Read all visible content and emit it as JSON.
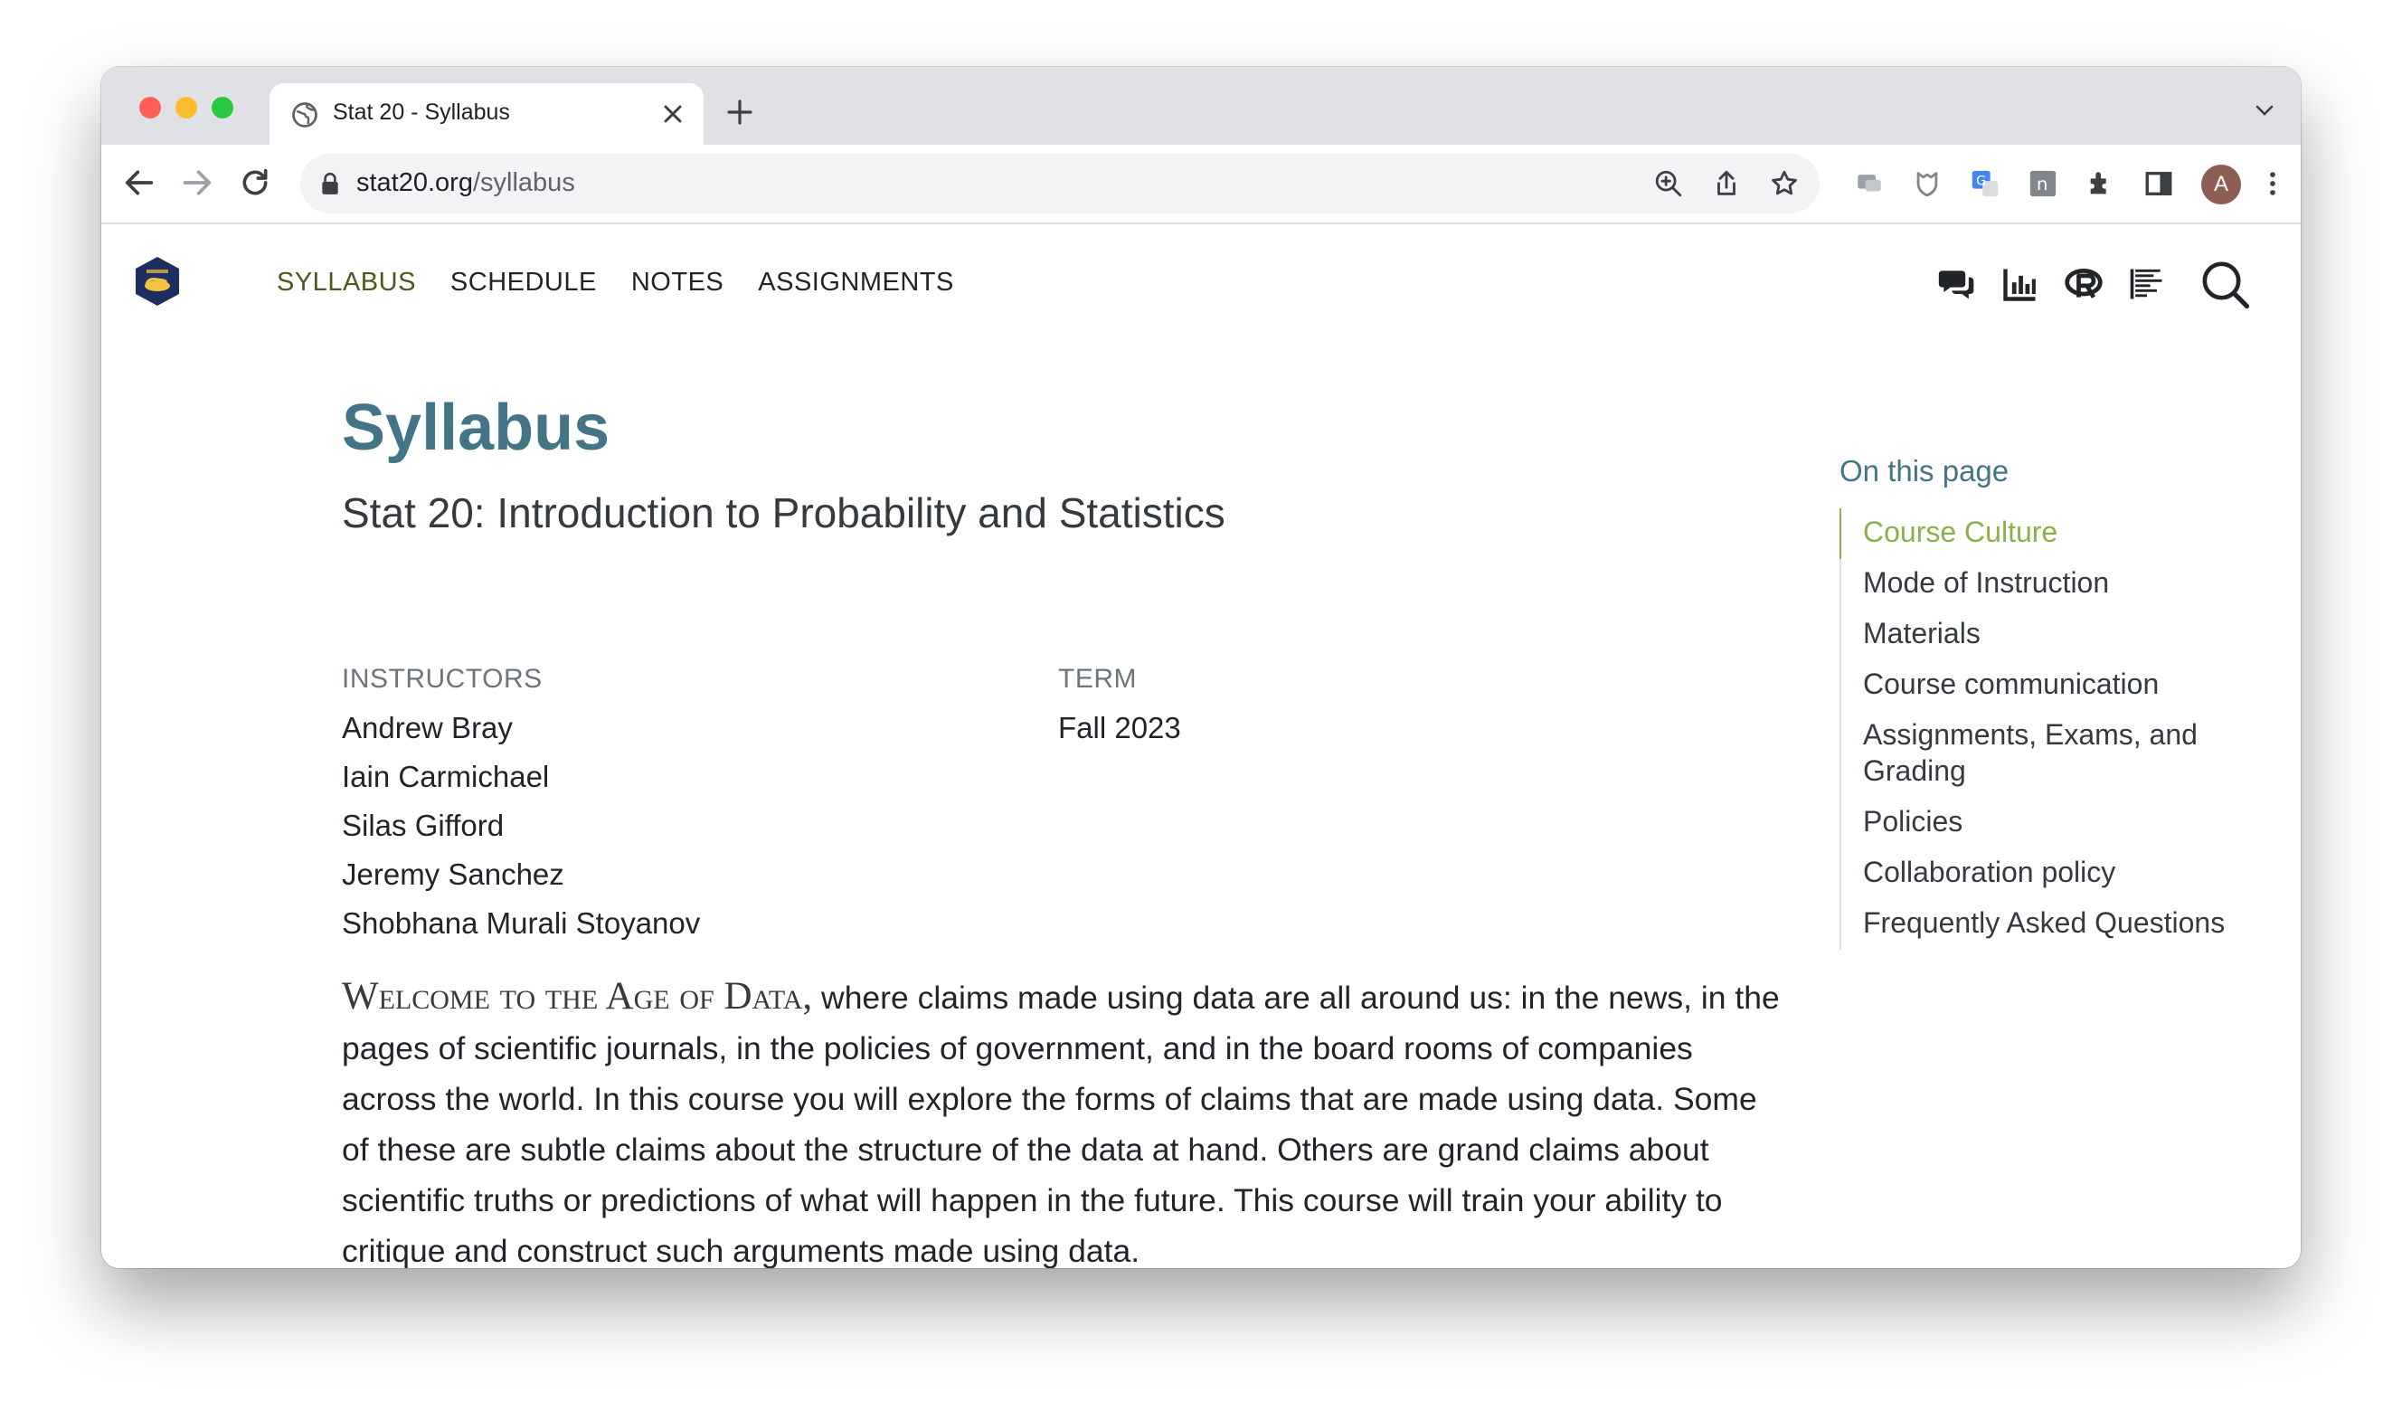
{
  "browser": {
    "tab_title": "Stat 20 - Syllabus",
    "url_domain": "stat20.org",
    "url_path": "/syllabus",
    "profile_initial": "A",
    "extensions": [
      "message-blocked-icon",
      "shield-extension-icon",
      "translate-icon",
      "n-extension-icon",
      "puzzle-icon",
      "sidepanel-icon"
    ]
  },
  "site": {
    "nav": {
      "syllabus": "SYLLABUS",
      "schedule": "SCHEDULE",
      "notes": "NOTES",
      "assignments": "ASSIGNMENTS"
    },
    "brand_color": "#447586",
    "accent_color": "#8cb04a"
  },
  "page": {
    "title": "Syllabus",
    "subtitle": "Stat 20: Introduction to Probability and Statistics",
    "instructors_label": "INSTRUCTORS",
    "instructors": [
      "Andrew Bray",
      "Iain Carmichael",
      "Silas Gifford",
      "Jeremy Sanchez",
      "Shobhana Murali Stoyanov"
    ],
    "term_label": "TERM",
    "term": "Fall 2023",
    "intro_lead": "Welcome to the Age of Data,",
    "intro_rest": " where claims made using data are all around us: in the news, in the pages of scientific journals, in the policies of government, and in the board rooms of companies across the world. In this course you will explore the forms of claims that are made using data. Some of these are subtle claims about the structure of the data at hand. Others are grand claims about scientific truths or predictions of what will happen in the future. This course will train your ability to critique and construct such arguments made using data."
  },
  "toc": {
    "title": "On this page",
    "items": [
      "Course Culture",
      "Mode of Instruction",
      "Materials",
      "Course communication",
      "Assignments, Exams, and Grading",
      "Policies",
      "Collaboration policy",
      "Frequently Asked Questions"
    ]
  }
}
